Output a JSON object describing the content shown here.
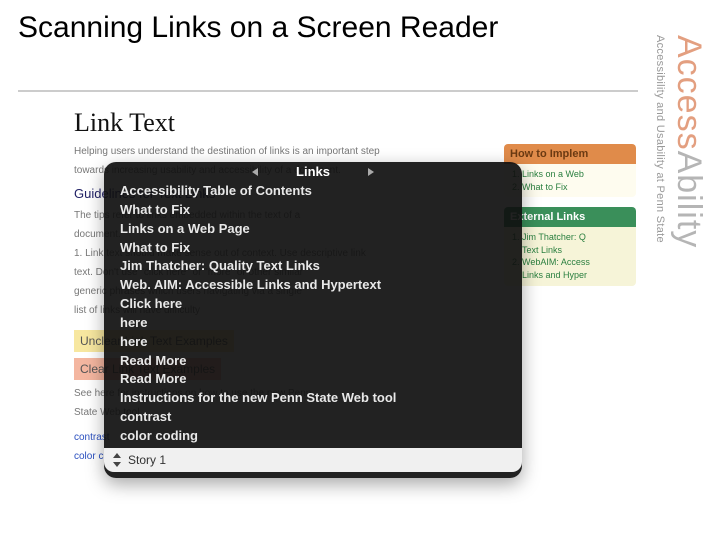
{
  "slide": {
    "title": "Scanning Links on a Screen Reader"
  },
  "brand": {
    "word_a": "Access",
    "word_b": "Ability",
    "subtitle": "Accessibility and Usability at Penn State"
  },
  "screenshot": {
    "heading": "Link Text",
    "bg_left": {
      "intro_a": "Helping users understand the destination of links is an important step",
      "intro_b": "towards increasing usability and accessibility of a document.",
      "guide_hd": "Guidelines for Text Links",
      "guide_a": "The tips refer to links embedded within the text of a",
      "guide_b": "document.",
      "rule1_a": "1. Link text should make sense out of context. Use descriptive link",
      "rule1_b": "text. Don't use \"click here\" or \"more\" or other similar",
      "rule1_c": "generic phrases which users navigating via a single",
      "rule1_d": "list of links will have difficulty",
      "bar1": "Unclear Link Text Examples",
      "bar2": "Clear Link Text Examples",
      "note1": "See here for instructions on how to use the new Penn",
      "note2": "State Web tool.",
      "lk1": "contrast",
      "lk2": "color coding"
    },
    "bg_right": {
      "impl_hd": "How to Implem",
      "impl_1": "Links on a Web",
      "impl_2": "What to Fix",
      "ext_hd": "External Links",
      "ext_1": "Jim Thatcher: Q",
      "ext_2": "Text Links",
      "ext_3": "WebAIM: Access",
      "ext_4": "Links and Hyper"
    }
  },
  "rotor": {
    "title": "Links",
    "items": [
      "Accessibility Table of Contents",
      "What to Fix",
      "Links on a Web Page",
      "What to Fix",
      "Jim Thatcher: Quality Text Links",
      "Web. AIM: Accessible Links and Hypertext",
      "Click here",
      "here",
      "here",
      "Read More",
      "Read More",
      "Instructions for the new Penn State Web tool",
      "contrast",
      "color coding"
    ],
    "footer": "Story 1"
  }
}
